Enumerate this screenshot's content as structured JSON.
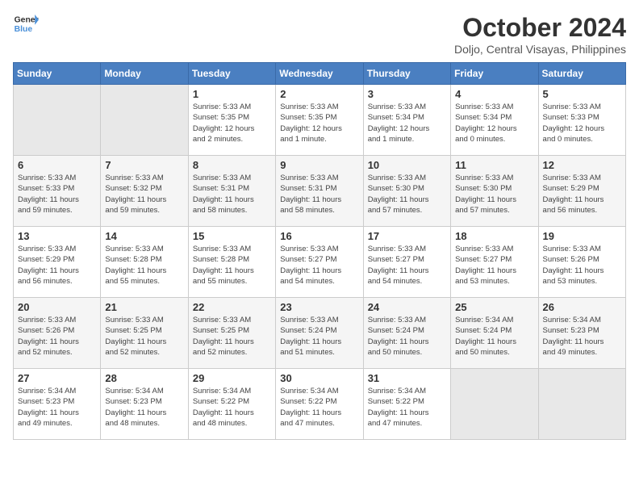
{
  "logo": {
    "line1": "General",
    "line2": "Blue"
  },
  "title": "October 2024",
  "subtitle": "Doljo, Central Visayas, Philippines",
  "days_of_week": [
    "Sunday",
    "Monday",
    "Tuesday",
    "Wednesday",
    "Thursday",
    "Friday",
    "Saturday"
  ],
  "weeks": [
    [
      {
        "day": "",
        "info": ""
      },
      {
        "day": "",
        "info": ""
      },
      {
        "day": "1",
        "info": "Sunrise: 5:33 AM\nSunset: 5:35 PM\nDaylight: 12 hours\nand 2 minutes."
      },
      {
        "day": "2",
        "info": "Sunrise: 5:33 AM\nSunset: 5:35 PM\nDaylight: 12 hours\nand 1 minute."
      },
      {
        "day": "3",
        "info": "Sunrise: 5:33 AM\nSunset: 5:34 PM\nDaylight: 12 hours\nand 1 minute."
      },
      {
        "day": "4",
        "info": "Sunrise: 5:33 AM\nSunset: 5:34 PM\nDaylight: 12 hours\nand 0 minutes."
      },
      {
        "day": "5",
        "info": "Sunrise: 5:33 AM\nSunset: 5:33 PM\nDaylight: 12 hours\nand 0 minutes."
      }
    ],
    [
      {
        "day": "6",
        "info": "Sunrise: 5:33 AM\nSunset: 5:33 PM\nDaylight: 11 hours\nand 59 minutes."
      },
      {
        "day": "7",
        "info": "Sunrise: 5:33 AM\nSunset: 5:32 PM\nDaylight: 11 hours\nand 59 minutes."
      },
      {
        "day": "8",
        "info": "Sunrise: 5:33 AM\nSunset: 5:31 PM\nDaylight: 11 hours\nand 58 minutes."
      },
      {
        "day": "9",
        "info": "Sunrise: 5:33 AM\nSunset: 5:31 PM\nDaylight: 11 hours\nand 58 minutes."
      },
      {
        "day": "10",
        "info": "Sunrise: 5:33 AM\nSunset: 5:30 PM\nDaylight: 11 hours\nand 57 minutes."
      },
      {
        "day": "11",
        "info": "Sunrise: 5:33 AM\nSunset: 5:30 PM\nDaylight: 11 hours\nand 57 minutes."
      },
      {
        "day": "12",
        "info": "Sunrise: 5:33 AM\nSunset: 5:29 PM\nDaylight: 11 hours\nand 56 minutes."
      }
    ],
    [
      {
        "day": "13",
        "info": "Sunrise: 5:33 AM\nSunset: 5:29 PM\nDaylight: 11 hours\nand 56 minutes."
      },
      {
        "day": "14",
        "info": "Sunrise: 5:33 AM\nSunset: 5:28 PM\nDaylight: 11 hours\nand 55 minutes."
      },
      {
        "day": "15",
        "info": "Sunrise: 5:33 AM\nSunset: 5:28 PM\nDaylight: 11 hours\nand 55 minutes."
      },
      {
        "day": "16",
        "info": "Sunrise: 5:33 AM\nSunset: 5:27 PM\nDaylight: 11 hours\nand 54 minutes."
      },
      {
        "day": "17",
        "info": "Sunrise: 5:33 AM\nSunset: 5:27 PM\nDaylight: 11 hours\nand 54 minutes."
      },
      {
        "day": "18",
        "info": "Sunrise: 5:33 AM\nSunset: 5:27 PM\nDaylight: 11 hours\nand 53 minutes."
      },
      {
        "day": "19",
        "info": "Sunrise: 5:33 AM\nSunset: 5:26 PM\nDaylight: 11 hours\nand 53 minutes."
      }
    ],
    [
      {
        "day": "20",
        "info": "Sunrise: 5:33 AM\nSunset: 5:26 PM\nDaylight: 11 hours\nand 52 minutes."
      },
      {
        "day": "21",
        "info": "Sunrise: 5:33 AM\nSunset: 5:25 PM\nDaylight: 11 hours\nand 52 minutes."
      },
      {
        "day": "22",
        "info": "Sunrise: 5:33 AM\nSunset: 5:25 PM\nDaylight: 11 hours\nand 52 minutes."
      },
      {
        "day": "23",
        "info": "Sunrise: 5:33 AM\nSunset: 5:24 PM\nDaylight: 11 hours\nand 51 minutes."
      },
      {
        "day": "24",
        "info": "Sunrise: 5:33 AM\nSunset: 5:24 PM\nDaylight: 11 hours\nand 50 minutes."
      },
      {
        "day": "25",
        "info": "Sunrise: 5:34 AM\nSunset: 5:24 PM\nDaylight: 11 hours\nand 50 minutes."
      },
      {
        "day": "26",
        "info": "Sunrise: 5:34 AM\nSunset: 5:23 PM\nDaylight: 11 hours\nand 49 minutes."
      }
    ],
    [
      {
        "day": "27",
        "info": "Sunrise: 5:34 AM\nSunset: 5:23 PM\nDaylight: 11 hours\nand 49 minutes."
      },
      {
        "day": "28",
        "info": "Sunrise: 5:34 AM\nSunset: 5:23 PM\nDaylight: 11 hours\nand 48 minutes."
      },
      {
        "day": "29",
        "info": "Sunrise: 5:34 AM\nSunset: 5:22 PM\nDaylight: 11 hours\nand 48 minutes."
      },
      {
        "day": "30",
        "info": "Sunrise: 5:34 AM\nSunset: 5:22 PM\nDaylight: 11 hours\nand 47 minutes."
      },
      {
        "day": "31",
        "info": "Sunrise: 5:34 AM\nSunset: 5:22 PM\nDaylight: 11 hours\nand 47 minutes."
      },
      {
        "day": "",
        "info": ""
      },
      {
        "day": "",
        "info": ""
      }
    ]
  ]
}
